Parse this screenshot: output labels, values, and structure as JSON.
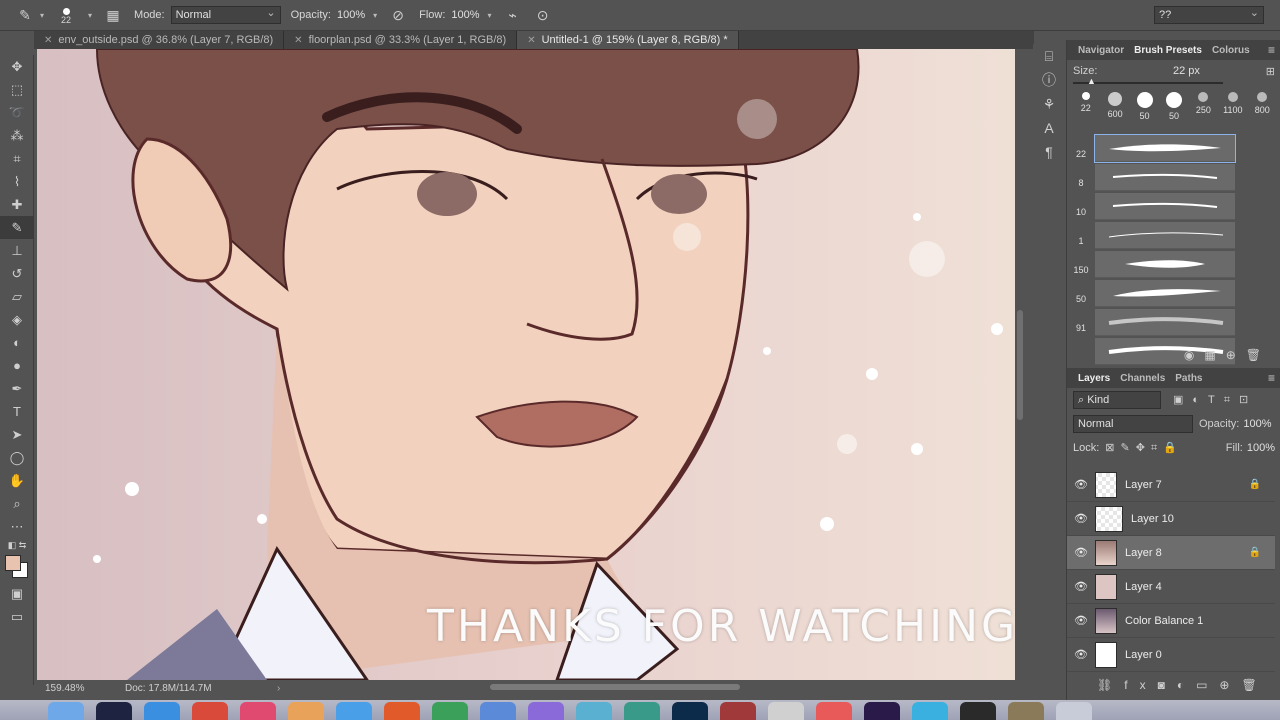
{
  "options_bar": {
    "brush_size": "22",
    "mode_label": "Mode:",
    "mode_value": "Normal",
    "opacity_label": "Opacity:",
    "opacity_value": "100%",
    "flow_label": "Flow:",
    "flow_value": "100%",
    "workspace_value": "??"
  },
  "tabs": [
    {
      "label": "env_outside.psd @ 36.8% (Layer 7, RGB/8)",
      "active": false
    },
    {
      "label": "floorplan.psd @ 33.3% (Layer 1, RGB/8)",
      "active": false
    },
    {
      "label": "Untitled-1 @ 159% (Layer 8, RGB/8) *",
      "active": true
    }
  ],
  "canvas": {
    "watermark": "THANKS FOR WATCHING!  :-)"
  },
  "status_bar": {
    "zoom": "159.48%",
    "doc": "Doc: 17.8M/114.7M",
    "arrow": "›"
  },
  "brush_panel": {
    "tabs": [
      "Navigator",
      "Brush Presets",
      "Colorus"
    ],
    "size_label": "Size:",
    "size_value": "22 px",
    "presets": [
      "22",
      "600",
      "50",
      "50",
      "250",
      "1100",
      "800"
    ],
    "brushes": [
      "22",
      "8",
      "10",
      "1",
      "150",
      "50",
      "91",
      ""
    ]
  },
  "layers_panel": {
    "tabs": [
      "Layers",
      "Channels",
      "Paths"
    ],
    "kind_label": "Kind",
    "blend_mode": "Normal",
    "opacity_label": "Opacity:",
    "opacity_value": "100%",
    "lock_label": "Lock:",
    "fill_label": "Fill:",
    "fill_value": "100%",
    "layers": [
      {
        "name": "Layer 7",
        "locked": true,
        "selected": false
      },
      {
        "name": "Layer 10",
        "locked": false,
        "selected": false
      },
      {
        "name": "Layer 8",
        "locked": true,
        "selected": true
      },
      {
        "name": "Layer 4",
        "locked": false,
        "selected": false
      },
      {
        "name": "Color Balance 1",
        "locked": false,
        "selected": false
      },
      {
        "name": "Layer 0",
        "locked": false,
        "selected": false
      }
    ]
  },
  "colors": {
    "foreground": "#e8c4b0",
    "background": "#ffffff",
    "accent_selection": "#8db4ea"
  }
}
